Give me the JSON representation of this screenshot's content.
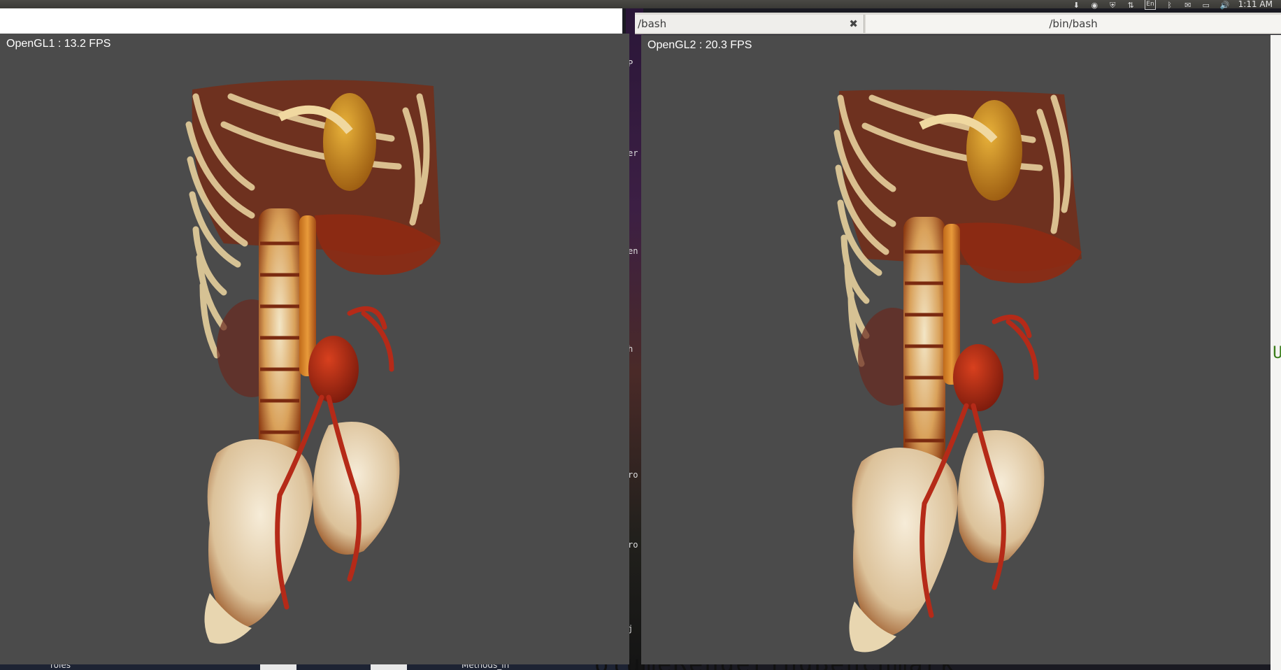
{
  "system_bar": {
    "tray_icons": [
      "download-icon",
      "chrome-icon",
      "shield-icon",
      "network-icon",
      "keyboard-icon",
      "bluetooth-icon",
      "mail-icon",
      "battery-icon",
      "volume-icon"
    ],
    "keyboard_label": "En",
    "clock": "1:11 AM"
  },
  "terminal": {
    "tabs": [
      {
        "label": "/bash"
      },
      {
        "label": "/bin/bash"
      }
    ],
    "close_glyph": "✖"
  },
  "windows": {
    "left": {
      "fps_label": "OpenGL1 : 13.2 FPS"
    },
    "right": {
      "fps_label": "OpenGL2 : 20.3 FPS"
    }
  },
  "background": {
    "taskbar_text_1": "roles",
    "taskbar_text_2": "Methods_in",
    "terminal_fragment": "olumeRenderingBenchmark"
  },
  "colors": {
    "viewport_bg": "#4b4b4b",
    "bone": "#e8d9b8",
    "vessel": "#b52a18",
    "tissue": "#c8601a"
  }
}
